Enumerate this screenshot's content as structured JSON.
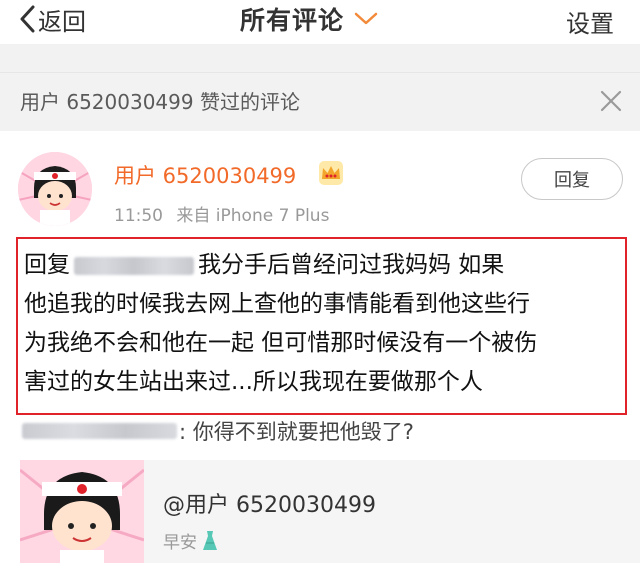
{
  "nav": {
    "back_label": "返回",
    "title": "所有评论",
    "settings_label": "设置"
  },
  "liked_bar": {
    "text": "用户 6520030499 赞过的评论"
  },
  "comment": {
    "username": "用户 6520030499",
    "time": "11:50",
    "source": "来自 iPhone 7 Plus",
    "reply_label": "回复",
    "prefix": "回复",
    "line1": "我分手后曾经问过我妈妈 如果",
    "line2": "他追我的时候我去网上查他的事情能看到他这些行",
    "line3": "为我绝不会和他在一起 但可惜那时候没有一个被伤",
    "line4": "害过的女生站出来过...所以我现在要做那个人"
  },
  "quoted": {
    "text": ": 你得不到就要把他毁了?"
  },
  "card": {
    "username": "@用户 6520030499",
    "subtitle": "早安"
  },
  "colors": {
    "accent": "#f26a29",
    "highlight_border": "#e0222b",
    "muted": "#999999"
  }
}
